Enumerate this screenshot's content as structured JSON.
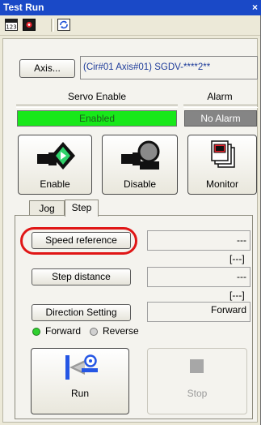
{
  "window": {
    "title": "Test Run",
    "close_glyph": "×"
  },
  "toolbar": {
    "icons": [
      "calc-123-icon",
      "record-red-icon",
      "refresh-icon"
    ]
  },
  "axis": {
    "button_label": "Axis...",
    "value": "(Cir#01 Axis#01) SGDV-****2**"
  },
  "servo": {
    "header": "Servo Enable",
    "status": "Enabled",
    "status_color": "#18e81a"
  },
  "alarm": {
    "header": "Alarm",
    "status": "No Alarm",
    "status_color": "#858585"
  },
  "actions": {
    "enable_label": "Enable",
    "disable_label": "Disable",
    "monitor_label": "Monitor"
  },
  "tabs": {
    "jog": "Jog",
    "step": "Step",
    "active": "Step"
  },
  "step": {
    "speed_reference": {
      "label": "Speed reference",
      "value": "---",
      "unit": "[---]"
    },
    "step_distance": {
      "label": "Step distance",
      "value": "---",
      "unit": "[---]"
    },
    "direction": {
      "label": "Direction Setting",
      "value": "Forward"
    },
    "radio": {
      "forward": "Forward",
      "reverse": "Reverse",
      "selected": "Forward"
    }
  },
  "run": {
    "run_label": "Run",
    "stop_label": "Stop"
  },
  "colors": {
    "highlight": "#e01616",
    "title_bar": "#1a49c7"
  }
}
